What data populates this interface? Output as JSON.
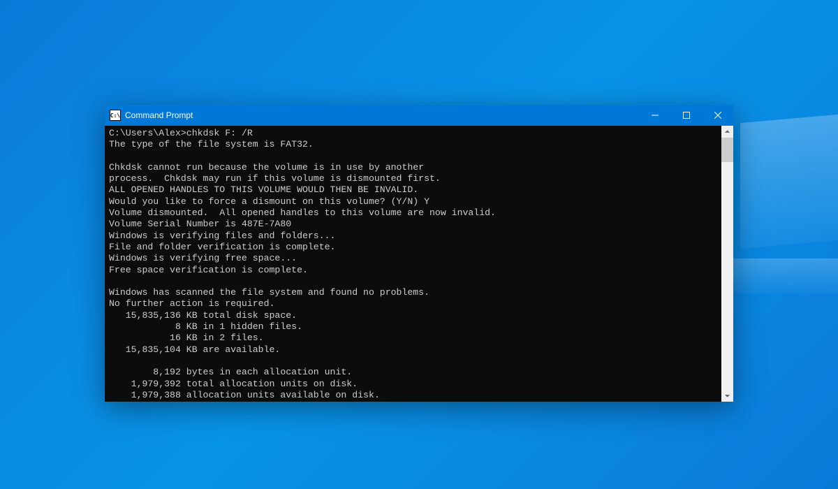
{
  "window": {
    "title": "Command Prompt",
    "icon_glyph": "C:\\"
  },
  "terminal": {
    "lines": [
      "C:\\Users\\Alex>chkdsk F: /R",
      "The type of the file system is FAT32.",
      "",
      "Chkdsk cannot run because the volume is in use by another",
      "process.  Chkdsk may run if this volume is dismounted first.",
      "ALL OPENED HANDLES TO THIS VOLUME WOULD THEN BE INVALID.",
      "Would you like to force a dismount on this volume? (Y/N) Y",
      "Volume dismounted.  All opened handles to this volume are now invalid.",
      "Volume Serial Number is 487E-7A80",
      "Windows is verifying files and folders...",
      "File and folder verification is complete.",
      "Windows is verifying free space...",
      "Free space verification is complete.",
      "",
      "Windows has scanned the file system and found no problems.",
      "No further action is required.",
      "   15,835,136 KB total disk space.",
      "            8 KB in 1 hidden files.",
      "           16 KB in 2 files.",
      "   15,835,104 KB are available.",
      "",
      "        8,192 bytes in each allocation unit.",
      "    1,979,392 total allocation units on disk.",
      "    1,979,388 allocation units available on disk."
    ]
  }
}
